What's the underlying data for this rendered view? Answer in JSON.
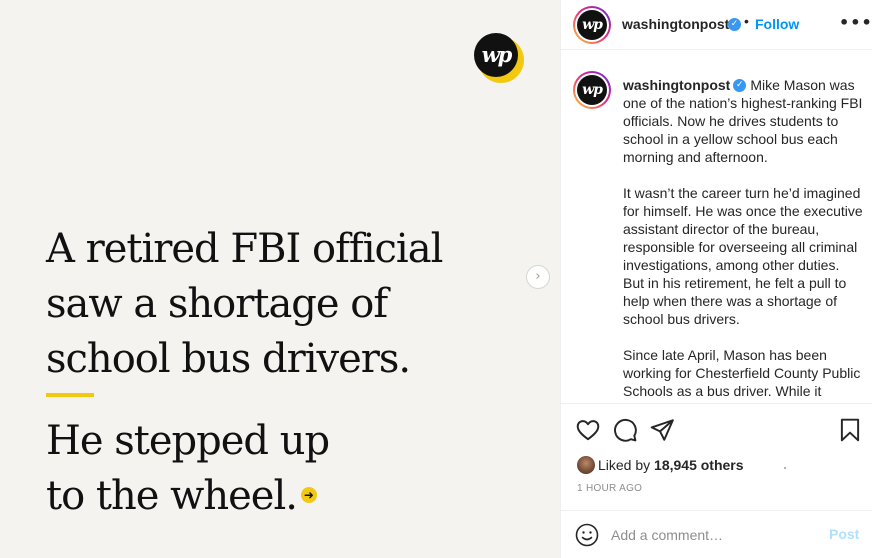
{
  "image": {
    "logo_text": "wp",
    "headline_lines": [
      "A retired FBI official",
      "saw a shortage of",
      "school bus drivers."
    ],
    "subhead_lines": [
      "He stepped up",
      "to the wheel."
    ],
    "arrow_glyph": "➜",
    "next_glyph": "›",
    "accent_color": "#f2c811"
  },
  "header": {
    "avatar_text": "wp",
    "username": "washingtonpost",
    "separator": "•",
    "follow_label": "Follow",
    "more_glyph": "•••"
  },
  "caption": {
    "username": "washingtonpost",
    "paragraphs": [
      "Mike Mason was one of the nation’s highest-ranking FBI officials. Now he drives students to school in a yellow school bus each morning and afternoon.",
      "It wasn’t the career turn he’d imagined for himself. He was once the executive assistant director of the bureau, responsible for overseeing all criminal investigations, among other duties. But in his retirement, he felt a pull to help when there was a shortage of school bus drivers.",
      "Since late April, Mason has been working for Chesterfield County Public Schools as a bus driver. While it differs drastically from his previous profession, “I feel the same sense of"
    ]
  },
  "likes": {
    "prefix": "Liked by ",
    "count": "18,945 others"
  },
  "timestamp": "1 HOUR AGO",
  "comment": {
    "placeholder": "Add a comment…",
    "post_label": "Post"
  },
  "colors": {
    "link": "#0095f6",
    "verified": "#3897f0",
    "post_disabled": "#b2dffc"
  }
}
